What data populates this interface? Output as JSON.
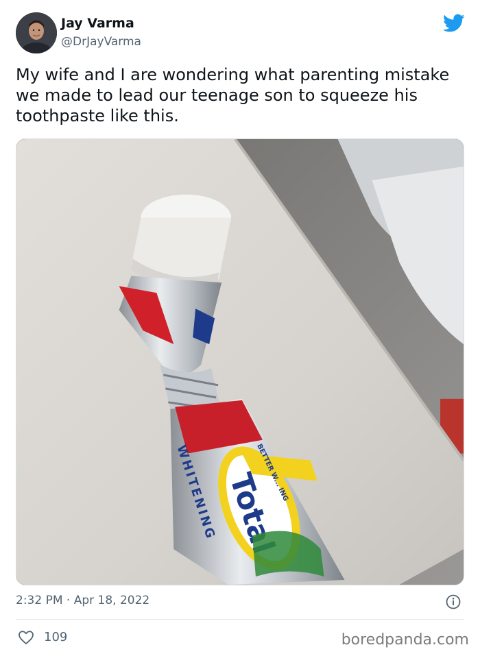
{
  "author": {
    "name": "Jay Varma",
    "handle": "@DrJayVarma",
    "avatar_icon": "avatar-photo"
  },
  "tweet": {
    "text": "My wife and I are wondering what parenting mistake we made to lead our teenage son to squeeze his toothpaste like this.",
    "timestamp": "2:32 PM · Apr 18, 2022",
    "likes": "109"
  },
  "media": {
    "brand_text": "Total",
    "side_text": "WHITENING",
    "band_text": "BETTER W... ING"
  },
  "icons": {
    "platform": "twitter-bird-icon",
    "info": "info-icon",
    "like": "heart-icon"
  },
  "watermark": "boredpanda.com",
  "colors": {
    "twitter_blue": "#1d9bf0",
    "secondary_text": "#536471",
    "primary_text": "#0f1419"
  }
}
